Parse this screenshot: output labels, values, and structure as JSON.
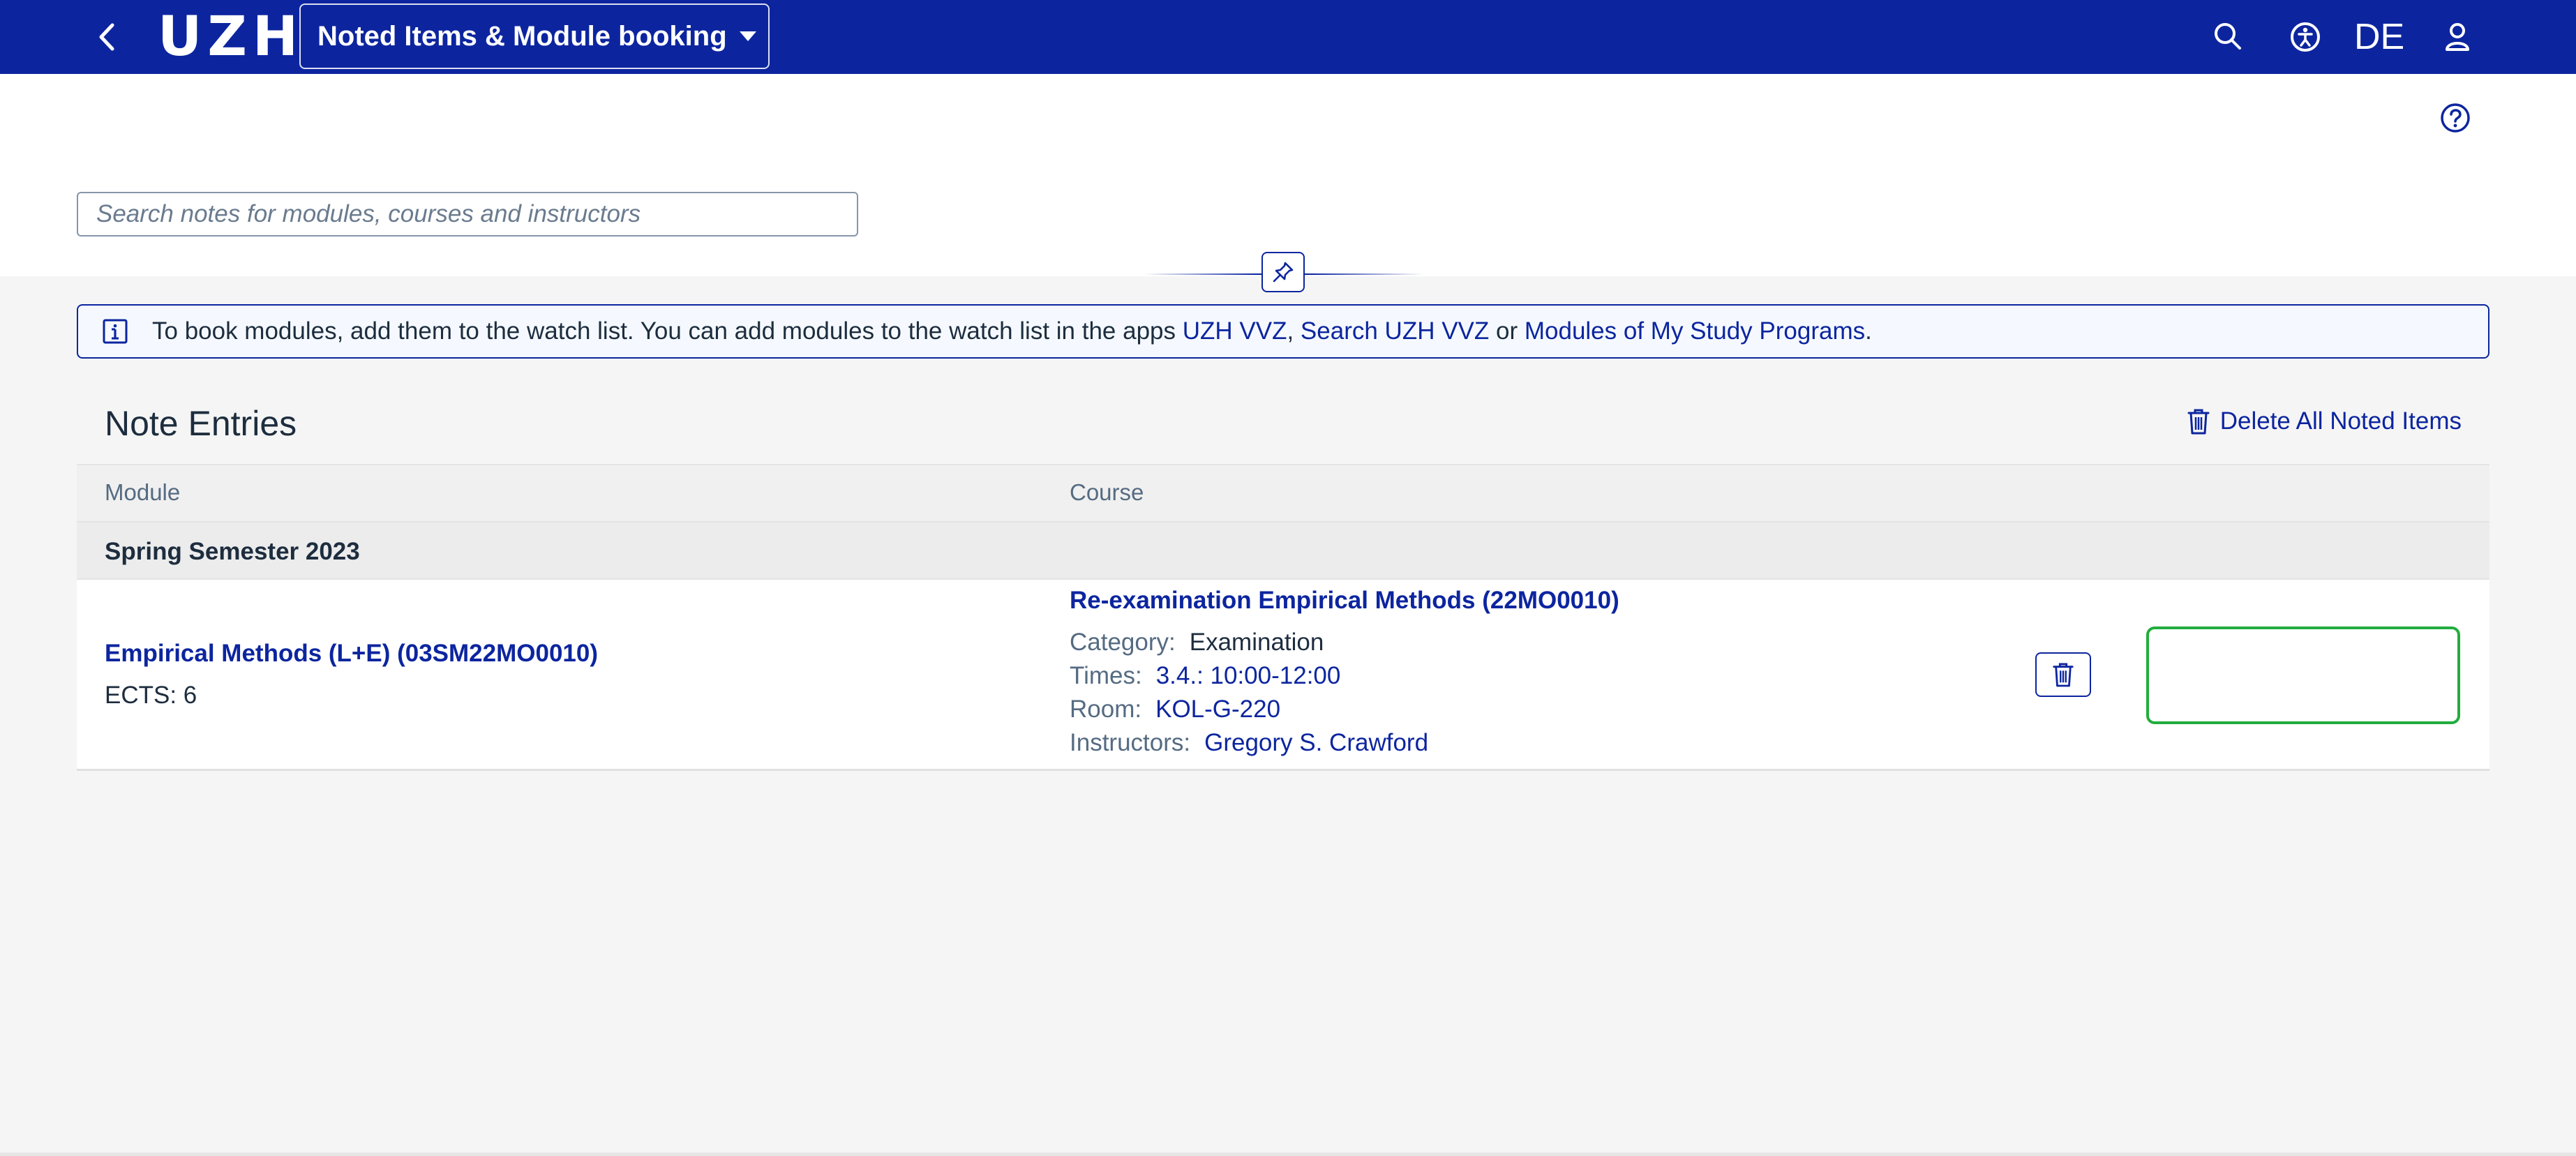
{
  "shell": {
    "logo": "UZH",
    "app_title": "Noted Items & Module booking",
    "language": "DE",
    "icons": [
      "back-icon",
      "search-icon",
      "accessibility-icon",
      "user-icon"
    ],
    "brand_color": "#0c259f"
  },
  "header": {
    "search_placeholder": "Search notes for modules, courses and instructors",
    "icons": [
      "help-icon",
      "pin-icon"
    ]
  },
  "info": {
    "text_before": "To book modules, add them to the watch list. You can add modules to the watch list in the apps ",
    "link1": "UZH VVZ",
    "sep1": ", ",
    "link2": "Search UZH VVZ",
    "sep2": " or ",
    "link3": "Modules of My Study Programs",
    "text_after": "."
  },
  "card": {
    "title": "Note Entries",
    "delete_all": "Delete All Noted Items",
    "columns": {
      "module": "Module",
      "course": "Course"
    },
    "group": "Spring Semester 2023",
    "row": {
      "module": "Empirical Methods (L+E) (03SM22MO0010)",
      "ects": "ECTS: 6",
      "course": "Re-examination Empirical Methods (22MO0010)",
      "category_label": "Category:",
      "category_value": "Examination",
      "times_label": "Times:",
      "times_value": "3.4.: 10:00-12:00",
      "room_label": "Room:",
      "room_value": "KOL-G-220",
      "instructors_label": "Instructors:",
      "instructors_value": "Gregory S. Crawford"
    },
    "booking_slot_color": "#22ad3e"
  }
}
